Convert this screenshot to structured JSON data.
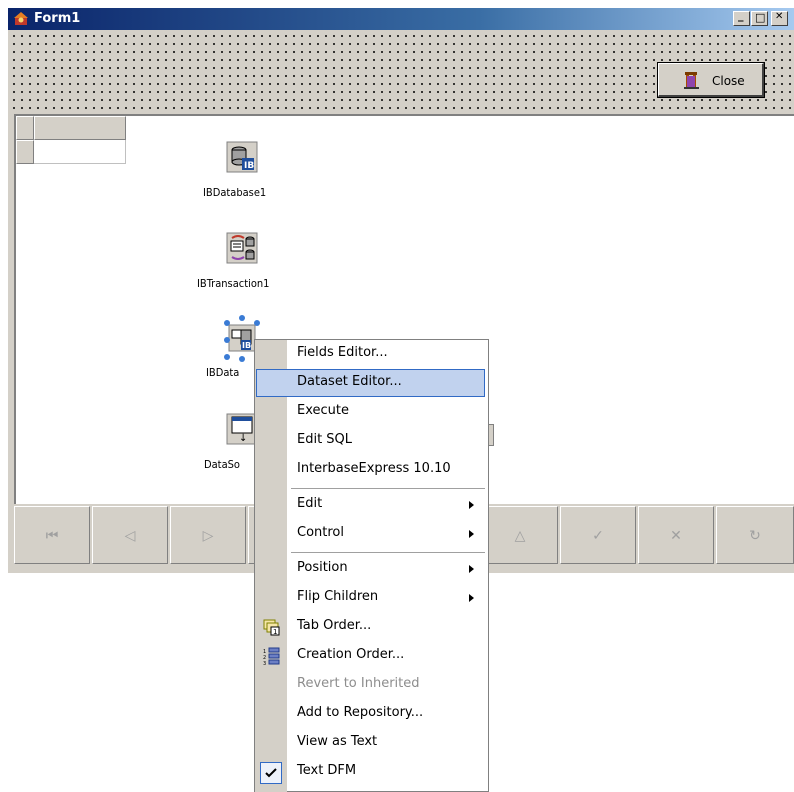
{
  "window": {
    "title": "Form1",
    "minimize_glyph": "_",
    "maximize_glyph": "□",
    "close_glyph": "✕"
  },
  "toolbar": {
    "close_label": "Close",
    "close_icon": "door-exit-icon"
  },
  "components": [
    {
      "name": "IBDatabase1",
      "icon": "database-icon"
    },
    {
      "name": "IBTransaction1",
      "icon": "transaction-icon"
    },
    {
      "name": "IBData",
      "icon": "dataset-icon"
    },
    {
      "name": "DataSo",
      "icon": "datasource-icon"
    }
  ],
  "navigator": {
    "buttons": [
      {
        "name": "first",
        "glyph": "⏮"
      },
      {
        "name": "prior",
        "glyph": "◁"
      },
      {
        "name": "next",
        "glyph": "▷"
      },
      {
        "name": "last",
        "glyph": "⏭"
      },
      {
        "name": "insert",
        "glyph": "+"
      },
      {
        "name": "delete",
        "glyph": "−"
      },
      {
        "name": "edit",
        "glyph": "△"
      },
      {
        "name": "post",
        "glyph": "✓"
      },
      {
        "name": "cancel",
        "glyph": "✕"
      },
      {
        "name": "refresh",
        "glyph": "↻"
      }
    ]
  },
  "context_menu": {
    "items": [
      {
        "label": "Fields Editor...",
        "accel": "t"
      },
      {
        "label": "Dataset Editor...",
        "accel": "D",
        "highlighted": true
      },
      {
        "label": "Execute",
        "accel": "x"
      },
      {
        "label": "Edit SQL",
        "accel": "S"
      },
      {
        "label": "InterbaseExpress 10.10",
        "accel": "b"
      },
      {
        "label": "Edit",
        "accel": "E",
        "submenu": true
      },
      {
        "label": "Control",
        "accel": "C",
        "submenu": true
      },
      {
        "label": "Position",
        "accel": "P",
        "submenu": true
      },
      {
        "label": "Flip Children",
        "accel": "h",
        "submenu": true
      },
      {
        "label": "Tab Order...",
        "accel": "O",
        "icon": "tab-order-icon"
      },
      {
        "label": "Creation Order...",
        "accel": "n",
        "icon": "creation-order-icon"
      },
      {
        "label": "Revert to Inherited",
        "accel": "I",
        "disabled": true
      },
      {
        "label": "Add to Repository...",
        "accel": "R"
      },
      {
        "label": "View as Text",
        "accel": "V"
      },
      {
        "label": "Text DFM",
        "accel": "F",
        "checked": true
      }
    ]
  },
  "colors": {
    "face": "#d4d0c8",
    "highlight": "#c1d2ee",
    "highlight_border": "#316ac5",
    "title_start": "#0a246a",
    "title_end": "#a6caf0"
  }
}
